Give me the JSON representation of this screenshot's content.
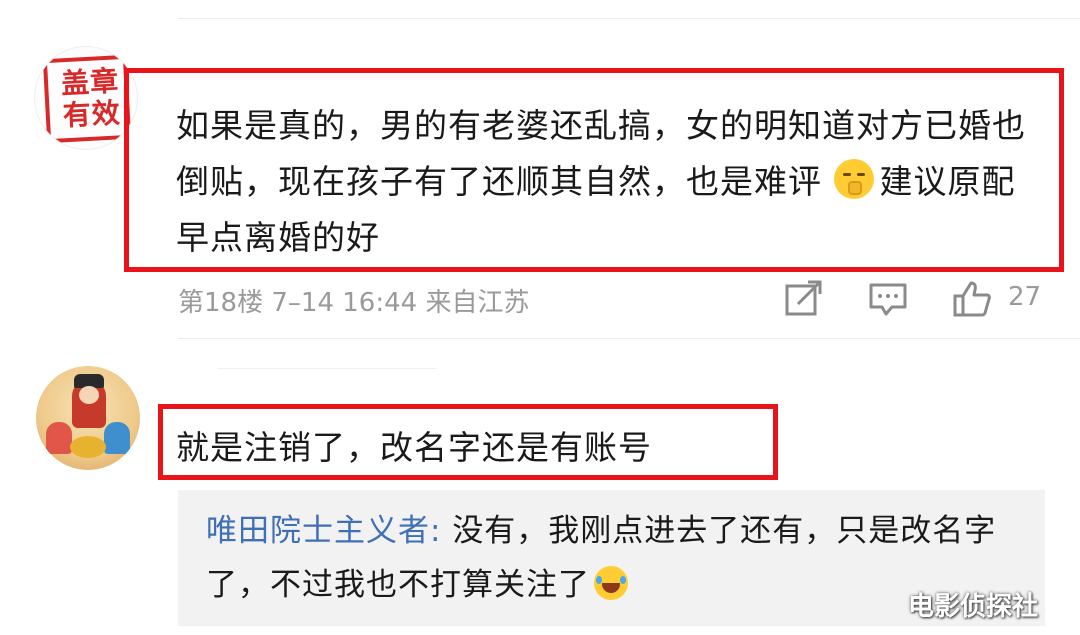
{
  "comment1": {
    "avatar_text": "盖章有效",
    "text_before_emoji": "如果是真的，男的有老婆还乱搞，女的明知道对方已婚也倒贴，现在孩子有了还顺其自然，也是难评",
    "emoji": "shushing-face-emoji",
    "text_after_emoji": "建议原配早点离婚的好",
    "floor": "第18楼",
    "time": "7–14 16:44",
    "location": "来自江苏",
    "like_count": "27",
    "highlight_color": "#e8141a"
  },
  "comment2": {
    "text": "就是注销了，改名字还是有账号",
    "reply": {
      "author": "唯田院士主义者",
      "separator": ": ",
      "text": "没有，我刚点进去了还有，只是改名字了，不过我也不打算关注了",
      "emoji": "laughing-tears-emoji"
    }
  },
  "watermark": "电影侦探社",
  "colors": {
    "author_link": "#3f6fb6",
    "meta_gray": "#9a9a9a",
    "reply_bg": "#f2f2f2"
  }
}
